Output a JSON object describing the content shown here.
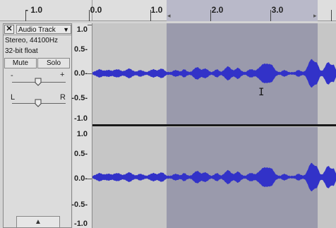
{
  "ruler": {
    "ticks": [
      {
        "label": "- 1.0",
        "name": "tick-minus-1"
      },
      {
        "label": "0.0",
        "name": "tick-0"
      },
      {
        "label": "1.0",
        "name": "tick-1"
      },
      {
        "label": "2.0",
        "name": "tick-2"
      },
      {
        "label": "3.0",
        "name": "tick-3"
      }
    ]
  },
  "track": {
    "close_symbol": "✕",
    "name": "Audio Track",
    "dropdown_symbol": "▼",
    "format": "Stereo, 44100Hz",
    "bit_depth": "32-bit float",
    "mute_label": "Mute",
    "solo_label": "Solo",
    "gain_minus": "-",
    "gain_plus": "+",
    "pan_left": "L",
    "pan_right": "R",
    "collapse_symbol": "▲"
  },
  "vertical_ruler": {
    "labels": [
      "1.0",
      "0.5-",
      "0.0-",
      "-0.5-",
      "-1.0"
    ]
  },
  "cursor_symbol": "I",
  "colors": {
    "waveform": "#3232c8",
    "selection": "#9a9aac",
    "background": "#c6c6c6"
  }
}
